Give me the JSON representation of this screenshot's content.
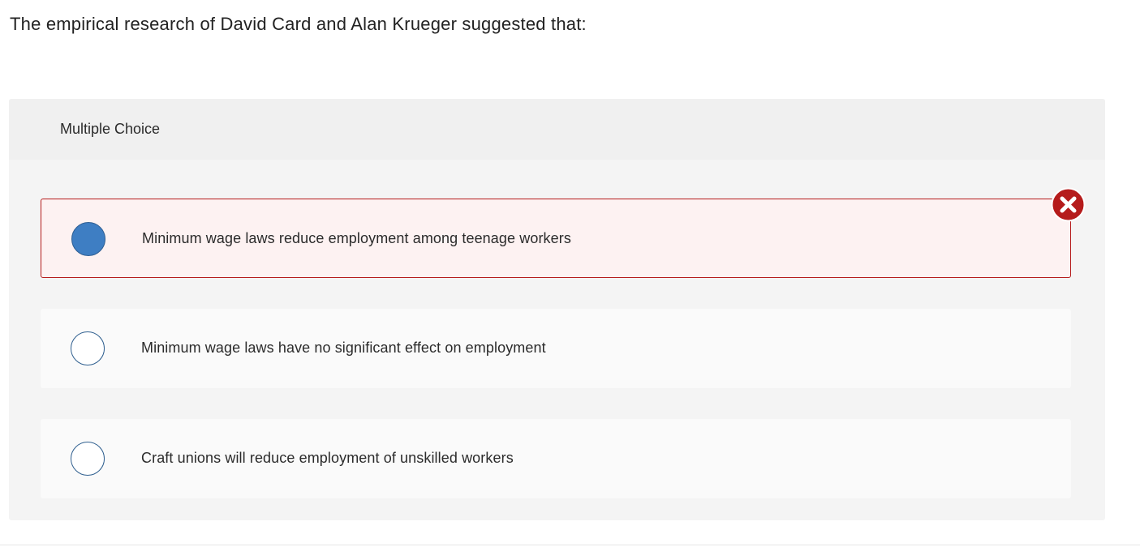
{
  "question": {
    "text": "The empirical research of David Card and Alan Krueger suggested that:"
  },
  "panel": {
    "header_label": "Multiple Choice",
    "options": [
      {
        "label": "Minimum wage laws reduce employment among teenage workers",
        "selected": true,
        "status": "incorrect"
      },
      {
        "label": "Minimum wage laws have no significant effect on employment",
        "selected": false
      },
      {
        "label": "Craft unions will reduce employment of unskilled workers",
        "selected": false
      }
    ]
  },
  "icons": {
    "incorrect_marker": "x-circle-icon"
  },
  "colors": {
    "selected_radio": "#3e7ec3",
    "incorrect_border": "#b51b1b",
    "incorrect_background": "#fdf2f2",
    "incorrect_icon": "#b51b1b"
  }
}
